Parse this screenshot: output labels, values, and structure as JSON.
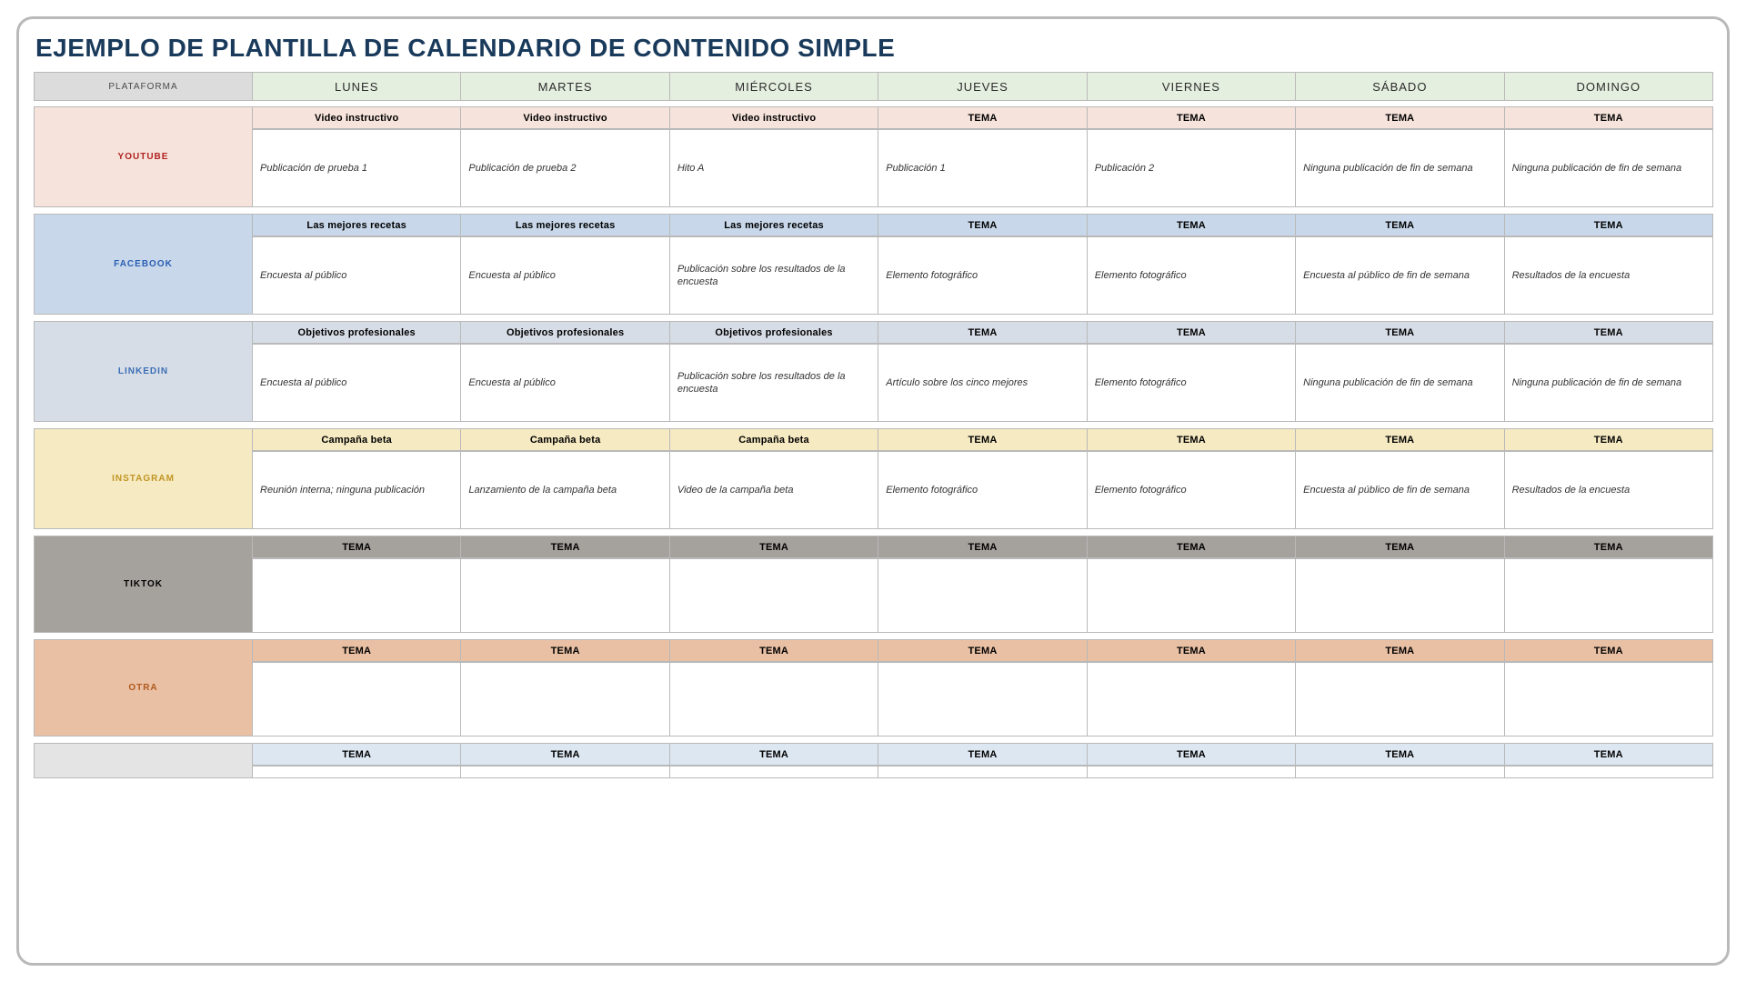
{
  "title": "EJEMPLO DE PLANTILLA DE CALENDARIO DE CONTENIDO SIMPLE",
  "header": {
    "platform_label": "PLATAFORMA",
    "days": [
      "LUNES",
      "MARTES",
      "MIÉRCOLES",
      "JUEVES",
      "VIERNES",
      "SÁBADO",
      "DOMINGO"
    ]
  },
  "sections": [
    {
      "key": "youtube",
      "label": "YOUTUBE",
      "topics": [
        "Video instructivo",
        "Video instructivo",
        "Video instructivo",
        "TEMA",
        "TEMA",
        "TEMA",
        "TEMA"
      ],
      "content": [
        "Publicación de prueba 1",
        "Publicación de prueba 2",
        "Hito A",
        "Publicación 1",
        "Publicación 2",
        "Ninguna publicación de fin de semana",
        "Ninguna publicación de fin de semana"
      ]
    },
    {
      "key": "facebook",
      "label": "FACEBOOK",
      "topics": [
        "Las mejores recetas",
        "Las mejores recetas",
        "Las mejores recetas",
        "TEMA",
        "TEMA",
        "TEMA",
        "TEMA"
      ],
      "content": [
        "Encuesta al público",
        "Encuesta al público",
        "Publicación sobre los resultados de la encuesta",
        "Elemento fotográfico",
        "Elemento fotográfico",
        "Encuesta al público de fin de semana",
        "Resultados de la encuesta"
      ]
    },
    {
      "key": "linkedin",
      "label": "LINKEDIN",
      "topics": [
        "Objetivos profesionales",
        "Objetivos profesionales",
        "Objetivos profesionales",
        "TEMA",
        "TEMA",
        "TEMA",
        "TEMA"
      ],
      "content": [
        "Encuesta al público",
        "Encuesta al público",
        "Publicación sobre los resultados de la encuesta",
        "Artículo sobre los cinco mejores",
        "Elemento fotográfico",
        "Ninguna publicación de fin de semana",
        "Ninguna publicación de fin de semana"
      ]
    },
    {
      "key": "instagram",
      "label": "INSTAGRAM",
      "topics": [
        "Campaña beta",
        "Campaña beta",
        "Campaña beta",
        "TEMA",
        "TEMA",
        "TEMA",
        "TEMA"
      ],
      "content": [
        "Reunión interna; ninguna publicación",
        "Lanzamiento de la campaña beta",
        "Video de la campaña beta",
        "Elemento fotográfico",
        "Elemento fotográfico",
        "Encuesta al público de fin de semana",
        "Resultados de la encuesta"
      ]
    },
    {
      "key": "tiktok",
      "label": "TIKTOK",
      "topics": [
        "TEMA",
        "TEMA",
        "TEMA",
        "TEMA",
        "TEMA",
        "TEMA",
        "TEMA"
      ],
      "content": [
        "",
        "",
        "",
        "",
        "",
        "",
        ""
      ]
    },
    {
      "key": "otra",
      "label": "OTRA",
      "topics": [
        "TEMA",
        "TEMA",
        "TEMA",
        "TEMA",
        "TEMA",
        "TEMA",
        "TEMA"
      ],
      "content": [
        "",
        "",
        "",
        "",
        "",
        "",
        ""
      ]
    },
    {
      "key": "extra",
      "label": "",
      "topics": [
        "TEMA",
        "TEMA",
        "TEMA",
        "TEMA",
        "TEMA",
        "TEMA",
        "TEMA"
      ],
      "content": [
        "",
        "",
        "",
        "",
        "",
        "",
        ""
      ]
    }
  ]
}
